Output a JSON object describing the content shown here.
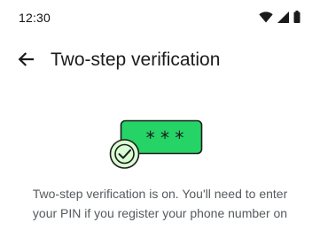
{
  "status_bar": {
    "time": "12:30",
    "icons": [
      "wifi-icon",
      "cellular-signal-icon",
      "battery-icon"
    ]
  },
  "app_bar": {
    "back_icon": "arrow-left-icon",
    "title": "Two-step verification"
  },
  "illustration": {
    "pin_mask": "* * *",
    "badge_icon": "check-circle-icon",
    "colors": {
      "card_fill": "#25d366",
      "badge_fill": "#d9fdd3",
      "outline": "#1c1c1c"
    }
  },
  "body": {
    "line_1": "Two-step verification is on. You'll need to enter",
    "line_2": "your PIN if you register your phone number on"
  }
}
